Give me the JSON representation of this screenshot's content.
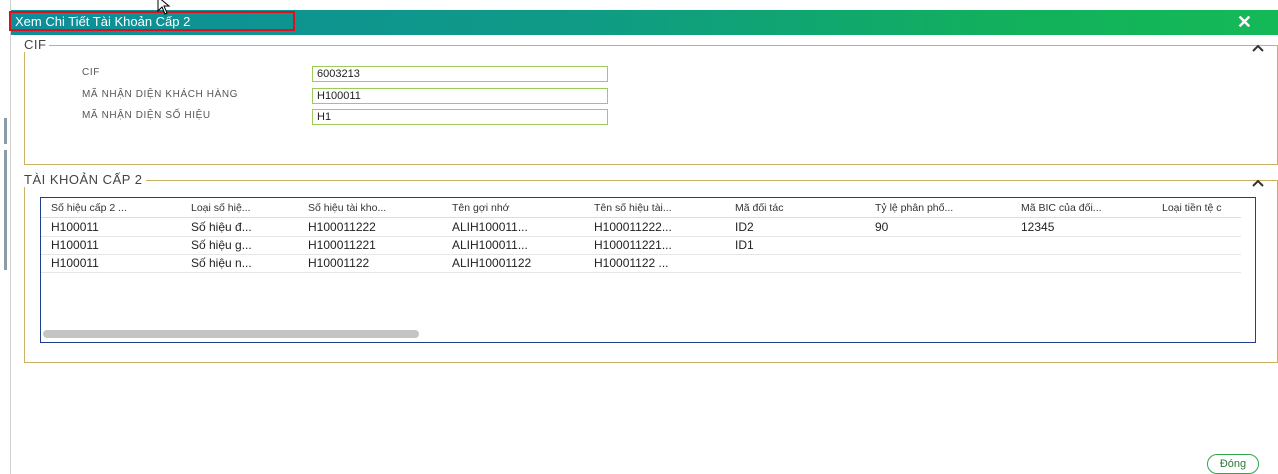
{
  "dialog": {
    "title": "Xem Chi Tiết Tài Khoản Cấp 2",
    "close_icon": "close-icon",
    "colors": {
      "title_gradient_start": "#0d8e9a",
      "title_gradient_end": "#14b957",
      "highlight_box": "#e0101a"
    }
  },
  "cif_section": {
    "legend": "CIF",
    "fields": [
      {
        "label": "CIF",
        "value": "6003213"
      },
      {
        "label": "MÃ NHẬN DIỆN KHÁCH HÀNG",
        "value": "H100011"
      },
      {
        "label": "MÃ NHẬN DIỆN SỐ HIỆU",
        "value": "H1"
      }
    ]
  },
  "accounts_section": {
    "legend": "TÀI KHOẢN CẤP 2",
    "columns": [
      "Số hiệu cấp 2 ...",
      "Loại số hiệ...",
      "Số hiệu tài kho...",
      "Tên gợi nhớ",
      "Tên số hiệu tài...",
      "Mã đối tác",
      "Tỷ lệ phân phố...",
      "Mã BIC của đối...",
      "Loại tiền tệ c"
    ],
    "rows": [
      [
        "H100011",
        "Số hiệu đ...",
        "H100011222",
        "ALIH100011...",
        "H100011222...",
        "ID2",
        "90",
        "12345",
        ""
      ],
      [
        "H100011",
        "Số hiệu g...",
        "H100011221",
        "ALIH100011...",
        "H100011221...",
        "ID1",
        "",
        "",
        ""
      ],
      [
        "H100011",
        "Số hiệu n...",
        "H10001122",
        "ALIH10001122",
        "H10001122 ...",
        "",
        "",
        "",
        ""
      ]
    ]
  },
  "footer": {
    "close_button": "Đóng"
  }
}
